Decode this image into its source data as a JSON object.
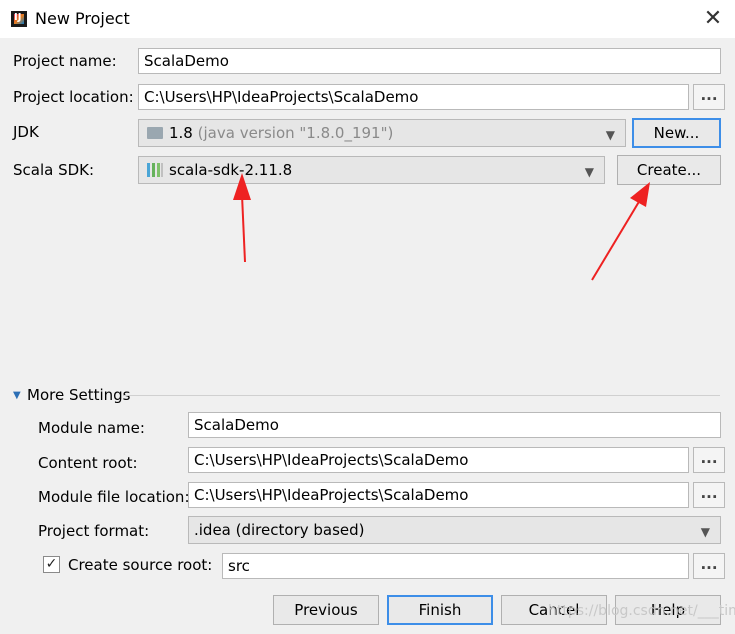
{
  "window": {
    "title": "New Project"
  },
  "form": {
    "project_name_label": "Project name:",
    "project_name_value": "ScalaDemo",
    "project_location_label": "Project location:",
    "project_location_value": "C:\\Users\\HP\\IdeaProjects\\ScalaDemo",
    "jdk_label": "JDK",
    "jdk_value": "1.8",
    "jdk_detail": "(java version \"1.8.0_191\")",
    "jdk_new_button": "New...",
    "scala_sdk_label": "Scala SDK:",
    "scala_sdk_value": "scala-sdk-2.11.8",
    "scala_create_button": "Create...",
    "browse_button": "..."
  },
  "more_settings": {
    "header": "More Settings",
    "module_name_label": "Module name:",
    "module_name_value": "ScalaDemo",
    "content_root_label": "Content root:",
    "content_root_value": "C:\\Users\\HP\\IdeaProjects\\ScalaDemo",
    "module_file_location_label": "Module file location:",
    "module_file_location_value": "C:\\Users\\HP\\IdeaProjects\\ScalaDemo",
    "project_format_label": "Project format:",
    "project_format_value": ".idea (directory based)",
    "create_source_root_label": "Create source root:",
    "create_source_root_checked": true,
    "source_root_value": "src"
  },
  "buttons": {
    "previous": "Previous",
    "finish": "Finish",
    "cancel": "Cancel",
    "help": "Help"
  },
  "watermark": "https://blog.csdn.net/___time",
  "colors": {
    "annotation_arrow": "#ee2222",
    "focus_border": "#3d8ee8"
  },
  "icons": {
    "app": "intellij-icon",
    "close": "close-icon",
    "jdk": "folder-icon",
    "scala_sdk": "library-icon",
    "collapse": "triangle-down-icon",
    "dropdown": "chevron-down-icon"
  }
}
